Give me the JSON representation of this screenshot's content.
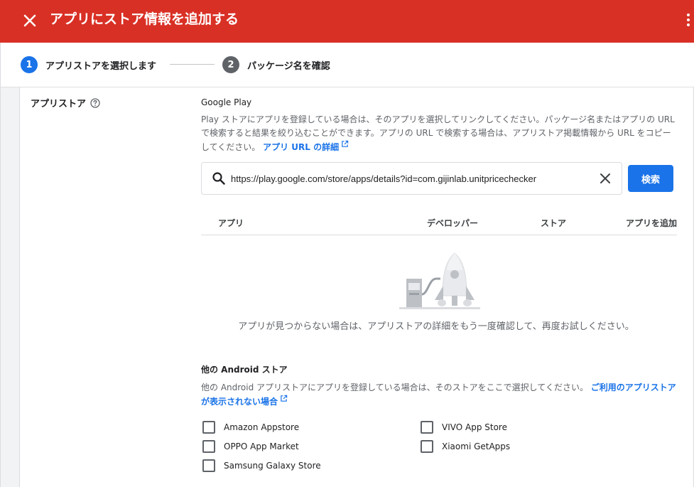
{
  "header": {
    "title": "アプリにストア情報を追加する"
  },
  "stepper": {
    "steps": [
      {
        "number": "1",
        "label": "アプリストアを選択します",
        "active": true
      },
      {
        "number": "2",
        "label": "パッケージ名を確認",
        "active": false
      }
    ]
  },
  "section": {
    "label": "アプリストア"
  },
  "google_play": {
    "title": "Google Play",
    "description": "Play ストアにアプリを登録している場合は、そのアプリを選択してリンクしてください。パッケージ名またはアプリの URL で検索すると結果を絞り込むことができます。アプリの URL で検索する場合は、アプリストア掲載情報から URL をコピーしてください。",
    "details_link": "アプリ URL の詳細"
  },
  "search": {
    "value": "https://play.google.com/store/apps/details?id=com.gijinlab.unitpricechecker",
    "button_label": "検索"
  },
  "table": {
    "columns": [
      "アプリ",
      "デベロッパー",
      "ストア",
      "アプリを追加"
    ]
  },
  "empty_state": {
    "message": "アプリが見つからない場合は、アプリストアの詳細をもう一度確認して、再度お試しください。"
  },
  "other_stores": {
    "title": "他の Android ストア",
    "description": "他の Android アプリストアにアプリを登録している場合は、そのストアをここで選択してください。",
    "link": "ご利用のアプリストアが表示されない場合",
    "options": [
      {
        "label": "Amazon Appstore",
        "checked": false
      },
      {
        "label": "VIVO App Store",
        "checked": false
      },
      {
        "label": "OPPO App Market",
        "checked": false
      },
      {
        "label": "Xiaomi GetApps",
        "checked": false
      },
      {
        "label": "Samsung Galaxy Store",
        "checked": false
      }
    ]
  },
  "colors": {
    "header_bg": "#d93025",
    "accent": "#1a73e8",
    "step_inactive": "#5f6368"
  },
  "icons": {
    "close": "close-icon",
    "more": "more-vert-icon",
    "help": "help-circle-icon",
    "external": "open-in-new-icon",
    "search": "search-icon",
    "clear": "clear-icon"
  }
}
